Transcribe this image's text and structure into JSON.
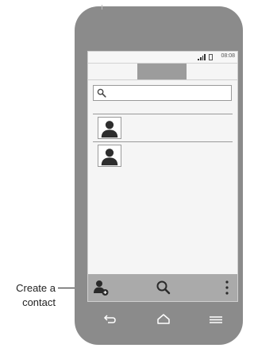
{
  "status_bar": {
    "time": "08:08"
  },
  "search": {
    "placeholder": ""
  },
  "contacts": [
    {
      "name": ""
    },
    {
      "name": ""
    }
  ],
  "action_bar": {
    "add_contact_icon": "add-person-icon",
    "search_icon": "search-icon",
    "menu_icon": "overflow-menu-icon"
  },
  "nav_bar": {
    "back_icon": "back-icon",
    "home_icon": "home-icon",
    "menu_icon": "menu-icon"
  },
  "callout": {
    "line1": "Create a",
    "line2": "contact"
  },
  "colors": {
    "phone_body": "#8b8b8b",
    "screen_bg": "#f5f5f5",
    "action_bar": "#aaaaaa",
    "active_tab": "#9c9c9c"
  }
}
